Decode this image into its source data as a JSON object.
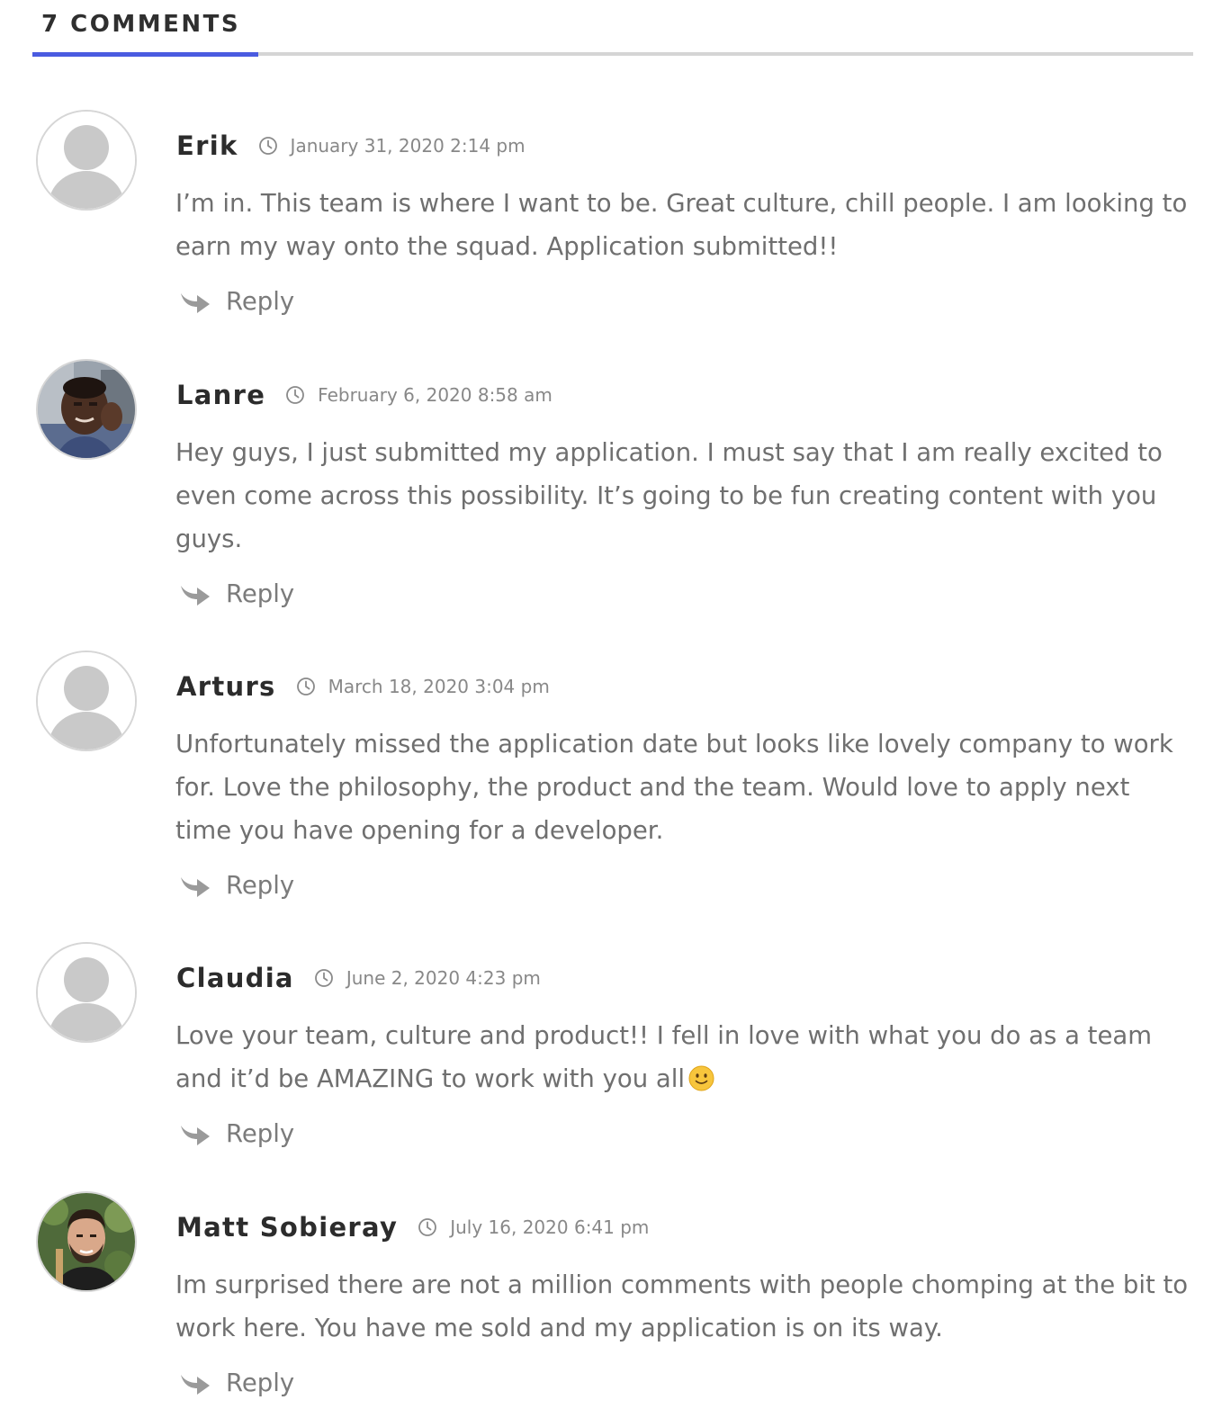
{
  "header": {
    "title": "7 COMMENTS"
  },
  "colors": {
    "accent": "#4a5be0",
    "divider": "#d5d5d5",
    "author": "#2c2c2c",
    "body_text": "#6f6f6f",
    "meta_text": "#888888"
  },
  "comments": [
    {
      "author": "Erik",
      "date": "January 31, 2020 2:14 pm",
      "avatar": "default-avatar-placeholder",
      "body": "I’m in. This team is where I want to be. Great culture, chill people. I am looking to earn my way onto the squad. Application submitted!!",
      "reply_label": "Reply"
    },
    {
      "author": "Lanre",
      "date": "February 6, 2020 8:58 am",
      "avatar": "user-photo",
      "body": "Hey guys, I just submitted my application. I must say that I am really excited to even come across this possibility. It’s going to be fun creating content with you guys.",
      "reply_label": "Reply"
    },
    {
      "author": "Arturs",
      "date": "March 18, 2020 3:04 pm",
      "avatar": "default-avatar-placeholder",
      "body": "Unfortunately missed the application date but looks like lovely company to work for. Love the philosophy, the product and the team. Would love to apply next time you have opening for a developer.",
      "reply_label": "Reply"
    },
    {
      "author": "Claudia",
      "date": "June 2, 2020 4:23 pm",
      "avatar": "default-avatar-placeholder",
      "body": "Love your team, culture and product!! I fell in love with what you do as a team and it’d be AMAZING to work with you all",
      "emoji": "slightly-smiling-face-icon",
      "reply_label": "Reply"
    },
    {
      "author": "Matt Sobieray",
      "date": "July 16, 2020 6:41 pm",
      "avatar": "user-photo",
      "body": "Im surprised there are not a million comments with people chomping at the bit to work here. You have me sold and my application is on its way.",
      "reply_label": "Reply"
    }
  ]
}
